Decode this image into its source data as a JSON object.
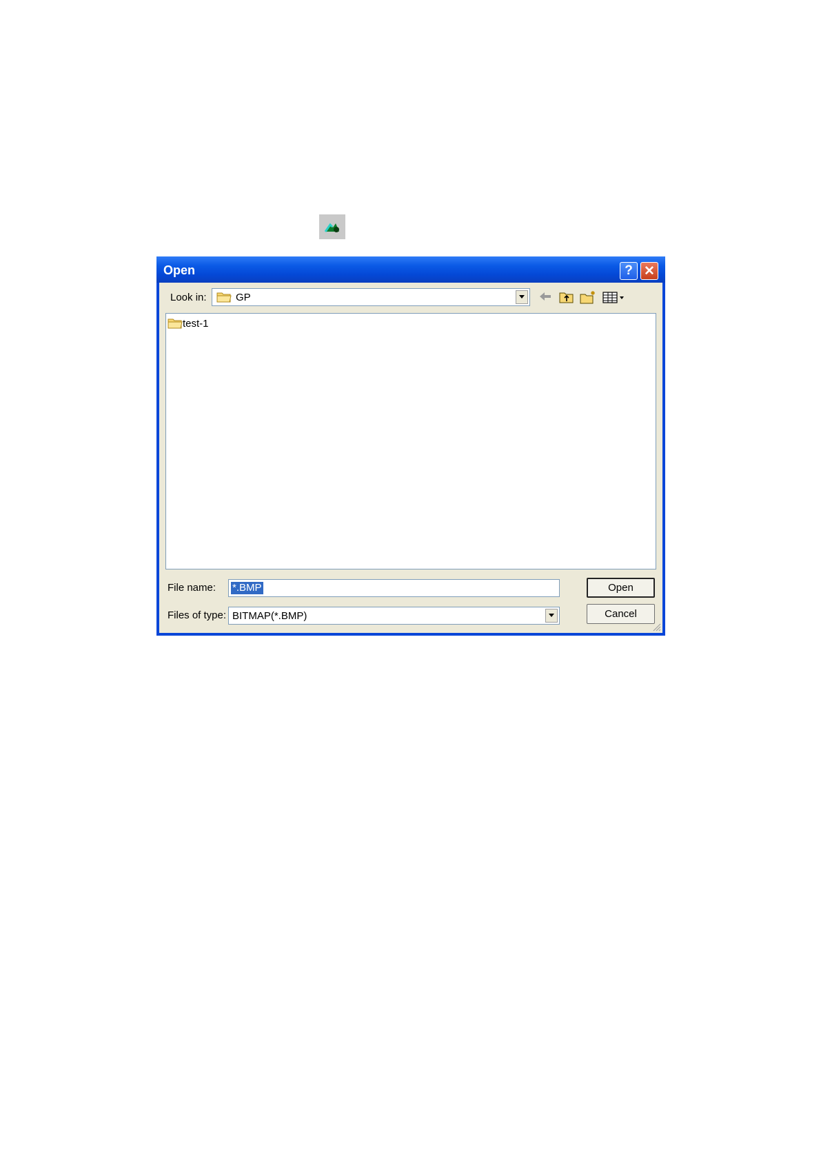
{
  "dialog": {
    "title": "Open",
    "help_glyph": "?",
    "close_glyph": "✕"
  },
  "lookin": {
    "label": "Look in:",
    "value": "GP"
  },
  "toolbar_icons": [
    "back-arrow-icon",
    "up-folder-icon",
    "new-folder-icon",
    "view-menu-icon"
  ],
  "files": [
    {
      "name": "test-1",
      "icon": "folder-icon"
    }
  ],
  "filename": {
    "label": "File name:",
    "value": "*.BMP"
  },
  "filetype": {
    "label": "Files of type:",
    "value": "BITMAP(*.BMP)"
  },
  "buttons": {
    "open": "Open",
    "cancel": "Cancel"
  },
  "colors": {
    "titlebar": "#0448d6",
    "client": "#ece9d8",
    "selection": "#316ac5"
  }
}
